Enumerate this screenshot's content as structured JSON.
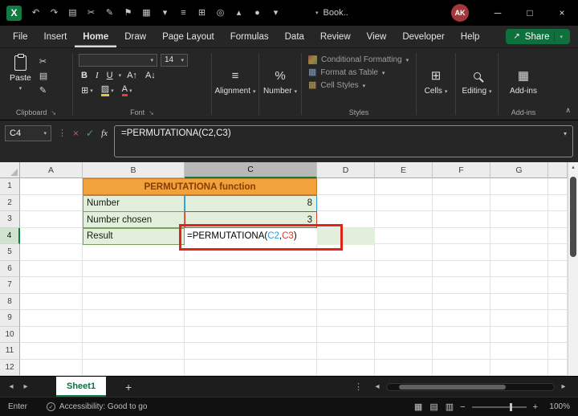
{
  "titlebar": {
    "app_logo_letter": "X",
    "qat_icons": [
      {
        "name": "undo-icon",
        "glyph": "↶"
      },
      {
        "name": "redo-icon",
        "glyph": "↷"
      },
      {
        "name": "copy-icon",
        "glyph": "▤"
      },
      {
        "name": "cut-icon",
        "glyph": "✂"
      },
      {
        "name": "format-painter-icon",
        "glyph": "✎"
      },
      {
        "name": "flag-icon",
        "glyph": "⚑"
      },
      {
        "name": "table-icon",
        "glyph": "▦"
      },
      {
        "name": "more-commands-icon",
        "glyph": "▾"
      },
      {
        "name": "list-icon",
        "glyph": "≡"
      },
      {
        "name": "borders-icon",
        "glyph": "⊞"
      },
      {
        "name": "camera-icon",
        "glyph": "◎"
      },
      {
        "name": "chart-icon",
        "glyph": "▴"
      },
      {
        "name": "record-icon",
        "glyph": "●"
      },
      {
        "name": "qat-dropdown-icon",
        "glyph": "▾"
      }
    ],
    "search_label": "Book..",
    "avatar_initials": "AK",
    "window_controls": {
      "minimize": "─",
      "maximize": "□",
      "close": "×"
    }
  },
  "glyphs": {
    "chevron_down": "▾",
    "chevron_up": "∧",
    "dialog_launcher": "↘",
    "dots": "⋮",
    "nav_left": "◂",
    "nav_right": "▸",
    "triangle_up": "▴",
    "minus": "−",
    "plus": "+",
    "cut": "✂",
    "copy": "▤",
    "brush": "✎",
    "borders": "⊞",
    "fill": "▨",
    "grid_table": "▦",
    "view_normal": "▦",
    "view_layout": "▤",
    "view_break": "▥",
    "percent": "%",
    "align_lines": "≡",
    "share": "↗",
    "check": "✓"
  },
  "ribbon": {
    "tabs": [
      "File",
      "Insert",
      "Home",
      "Draw",
      "Page Layout",
      "Formulas",
      "Data",
      "Review",
      "View",
      "Developer",
      "Help"
    ],
    "active_tab": "Home",
    "share_label": "Share",
    "paste_label": "Paste",
    "clipboard_group_label": "Clipboard",
    "font_name_value": "",
    "font_size_value": "14",
    "bold": "B",
    "italic": "I",
    "underline": "U",
    "grow_font_label": "A↑",
    "shrink_font_label": "A↓",
    "font_color_label": "A",
    "font_group_label": "Font",
    "alignment_label": "Alignment",
    "number_label": "Number",
    "conditional_formatting_label": "Conditional Formatting",
    "format_as_table_label": "Format as Table",
    "cell_styles_label": "Cell Styles",
    "styles_group_label": "Styles",
    "cells_label": "Cells",
    "editing_label": "Editing",
    "addins_button_label": "Add-ins",
    "addins_group_label": "Add-ins"
  },
  "formula_bar": {
    "name_box_value": "C4",
    "cancel_glyph": "×",
    "enter_glyph": "✓",
    "fx_label": "fx",
    "text": "=PERMUTATIONA(C2,C3)"
  },
  "grid": {
    "columns": [
      "A",
      "B",
      "C",
      "D",
      "E",
      "F",
      "G",
      ""
    ],
    "rows": [
      "1",
      "2",
      "3",
      "4",
      "5",
      "6",
      "7",
      "8",
      "9",
      "10",
      "11",
      "12"
    ],
    "selected_column": "C",
    "selected_row": "4"
  },
  "sheet": {
    "title_cell": "PERMUTATIONA function",
    "row2_label": "Number",
    "row2_value": "8",
    "row3_label": "Number chosen",
    "row3_value": "3",
    "row4_label": "Result",
    "formula": {
      "prefix": "=PERMUTATIONA(",
      "ref1": "C2",
      "comma": ",",
      "ref2": "C3",
      "close": ")"
    }
  },
  "sheet_bar": {
    "active_tab": "Sheet1",
    "add_sheet": "+"
  },
  "status_bar": {
    "mode": "Enter",
    "accessibility": "Accessibility: Good to go",
    "zoom": "100%"
  },
  "colors": {
    "accent_green": "#107C41",
    "title_fill": "#F2A23B",
    "title_text": "#873C00",
    "label_fill": "#E2EFDA",
    "ref_blue": "#2E9BD6",
    "ref_red": "#D23A32",
    "annotation_red": "#E0231B"
  }
}
